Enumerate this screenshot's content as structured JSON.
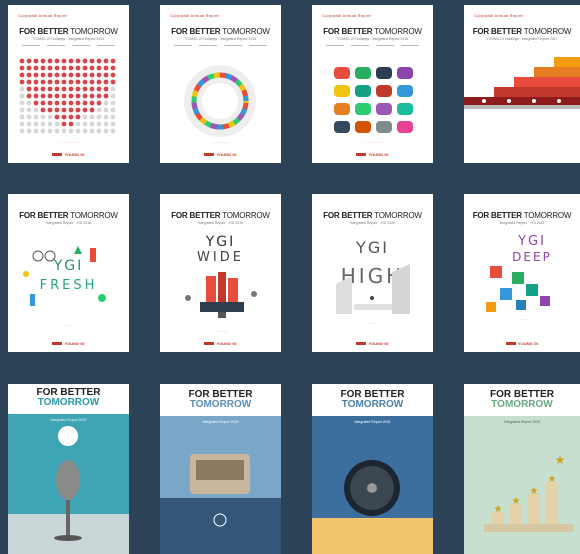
{
  "covers": [
    {
      "top_label": "Corporate Annual Report",
      "title_bold": "FOR BETTER",
      "title_light": " TOMORROW",
      "subtitle": "YOUNG-GI Holdings · Integrated Report 2014",
      "logo": "YOUNG GI"
    },
    {
      "top_label": "Corporate Annual Report",
      "title_bold": "FOR BETTER",
      "title_light": " TOMORROW",
      "subtitle": "YOUNG-GI Holdings · Integrated Report 2015",
      "logo": "YOUNG GI"
    },
    {
      "top_label": "Corporate Annual Report",
      "title_bold": "FOR BETTER",
      "title_light": " TOMORROW",
      "subtitle": "YOUNG-GI Holdings · Integrated Report 2016",
      "logo": "YOUNG GI"
    },
    {
      "top_label": "Corporate Annual Report",
      "title_bold": "FOR BETTER",
      "title_light": " TOMORROW",
      "subtitle": "YOUNG-GI Holdings · Integrated Report 2017",
      "logo": ""
    },
    {
      "title_bold": "FOR BETTER",
      "title_light": " TOMORROW",
      "subtitle": "Integrated Report · YGI 2018",
      "word": "FRESH",
      "ygi": "YGI",
      "logo": "YOUNG GI"
    },
    {
      "title_bold": "FOR BETTER",
      "title_light": " TOMORROW",
      "subtitle": "Integrated Report · YGI 2019",
      "word": "WIDE",
      "ygi": "YGI",
      "logo": "YOUNG GI"
    },
    {
      "title_bold": "FOR BETTER",
      "title_light": " TOMORROW",
      "subtitle": "Integrated Report · YGI 2020",
      "word": "HIGH",
      "ygi": "YGI",
      "logo": "YOUNG GI"
    },
    {
      "title_bold": "FOR BETTER",
      "title_light": " TOMORROW",
      "subtitle": "Integrated Report · YGI 2021",
      "word": "DEEP",
      "ygi": "YGI",
      "logo": "YOUNG GI"
    },
    {
      "title_line1": "FOR BETTER",
      "title_line2": "TOMORROW",
      "subtitle": "Integrated Report 2022"
    },
    {
      "title_line1": "FOR BETTER",
      "title_line2": "TOMORROW",
      "subtitle": "Integrated Report 2023"
    },
    {
      "title_line1": "FOR BETTER",
      "title_line2": "TOMORROW",
      "subtitle": "Integrated Report 2024"
    },
    {
      "title_line1": "FOR BETTER",
      "title_line2": "TOMORROW",
      "subtitle": "Integrated Report 2025"
    }
  ],
  "colors": {
    "background": "#2b4257",
    "accent": "#c0392b"
  }
}
